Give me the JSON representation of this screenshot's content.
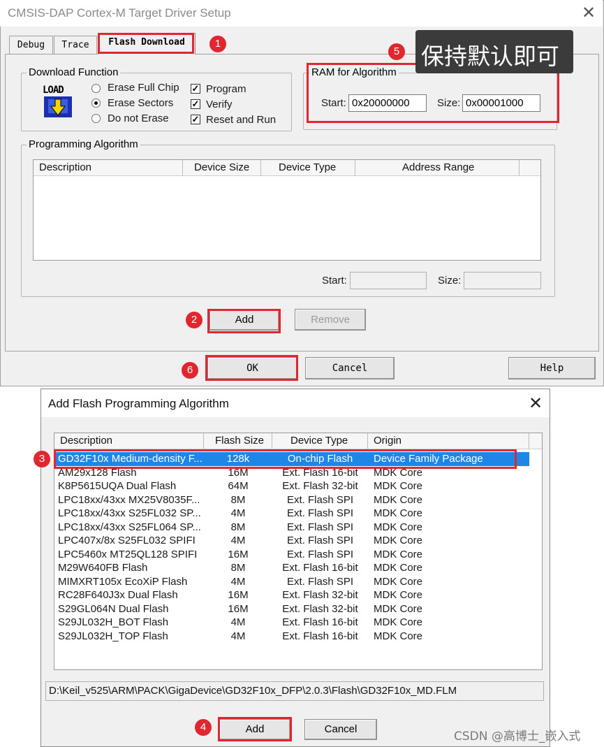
{
  "dialog1": {
    "title": "CMSIS-DAP Cortex-M Target Driver Setup",
    "close": "✕",
    "tabs": [
      "Debug",
      "Trace",
      "Flash Download"
    ],
    "download_function": {
      "title": "Download Function",
      "load_icon_text": "LOAD",
      "radios": [
        "Erase Full Chip",
        "Erase Sectors",
        "Do not Erase"
      ],
      "selected_radio": "Erase Sectors",
      "checkboxes": [
        "Program",
        "Verify",
        "Reset and Run"
      ],
      "checked": [
        true,
        true,
        true
      ]
    },
    "ram": {
      "title": "RAM for Algorithm",
      "start_label": "Start:",
      "start_value": "0x20000000",
      "size_label": "Size:",
      "size_value": "0x00001000"
    },
    "programming_algorithm": {
      "title": "Programming Algorithm",
      "columns": [
        "Description",
        "Device Size",
        "Device Type",
        "Address Range"
      ],
      "start_label": "Start:",
      "size_label": "Size:",
      "add_label": "Add",
      "remove_label": "Remove"
    },
    "buttons": {
      "ok": "OK",
      "cancel": "Cancel",
      "help": "Help"
    }
  },
  "annotations": {
    "badge1": "1",
    "badge2": "2",
    "badge3": "3",
    "badge4": "4",
    "badge5": "5",
    "badge6": "6",
    "note5": "保持默认即可",
    "red_color": "#e0262e"
  },
  "dialog2": {
    "title": "Add Flash Programming Algorithm",
    "close": "✕",
    "columns": [
      "Description",
      "Flash Size",
      "Device Type",
      "Origin"
    ],
    "rows": [
      [
        "GD32F10x Medium-density F...",
        "128k",
        "On-chip Flash",
        "Device Family Package"
      ],
      [
        "AM29x128 Flash",
        "16M",
        "Ext. Flash 16-bit",
        "MDK Core"
      ],
      [
        "K8P5615UQA Dual Flash",
        "64M",
        "Ext. Flash 32-bit",
        "MDK Core"
      ],
      [
        "LPC18xx/43xx MX25V8035F...",
        "8M",
        "Ext. Flash SPI",
        "MDK Core"
      ],
      [
        "LPC18xx/43xx S25FL032 SP...",
        "4M",
        "Ext. Flash SPI",
        "MDK Core"
      ],
      [
        "LPC18xx/43xx S25FL064 SP...",
        "8M",
        "Ext. Flash SPI",
        "MDK Core"
      ],
      [
        "LPC407x/8x S25FL032 SPIFI",
        "4M",
        "Ext. Flash SPI",
        "MDK Core"
      ],
      [
        "LPC5460x MT25QL128 SPIFI",
        "16M",
        "Ext. Flash SPI",
        "MDK Core"
      ],
      [
        "M29W640FB Flash",
        "8M",
        "Ext. Flash 16-bit",
        "MDK Core"
      ],
      [
        "MIMXRT105x EcoXiP Flash",
        "4M",
        "Ext. Flash SPI",
        "MDK Core"
      ],
      [
        "RC28F640J3x Dual Flash",
        "16M",
        "Ext. Flash 32-bit",
        "MDK Core"
      ],
      [
        "S29GL064N Dual Flash",
        "16M",
        "Ext. Flash 32-bit",
        "MDK Core"
      ],
      [
        "S29JL032H_BOT Flash",
        "4M",
        "Ext. Flash 16-bit",
        "MDK Core"
      ],
      [
        "S29JL032H_TOP Flash",
        "4M",
        "Ext. Flash 16-bit",
        "MDK Core"
      ]
    ],
    "selected_index": 0,
    "path": "D:\\Keil_v525\\ARM\\PACK\\GigaDevice\\GD32F10x_DFP\\2.0.3\\Flash\\GD32F10x_MD.FLM",
    "buttons": {
      "add": "Add",
      "cancel": "Cancel"
    }
  },
  "watermark": "CSDN @高博士_嵌入式"
}
